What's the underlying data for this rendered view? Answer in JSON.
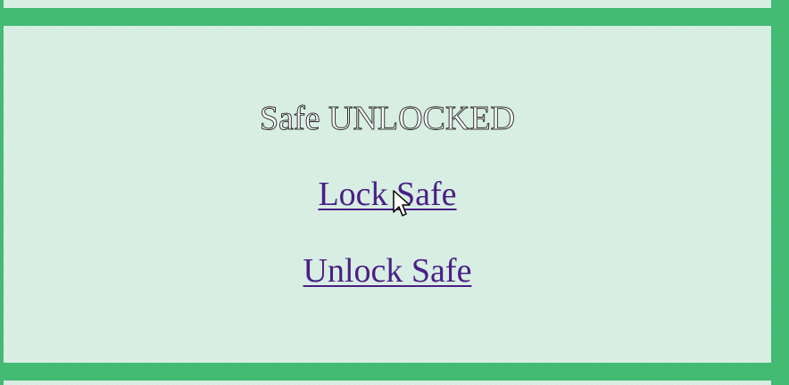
{
  "safe": {
    "status_text": "Safe UNLOCKED"
  },
  "actions": {
    "lock_label": "Lock Safe",
    "unlock_label": "Unlock Safe"
  },
  "colors": {
    "frame": "#43bb73",
    "panel": "#d6ede2",
    "link": "#4a1e86",
    "status_text": "#ffffff"
  },
  "icons": {
    "cursor": "mouse-pointer-icon"
  }
}
